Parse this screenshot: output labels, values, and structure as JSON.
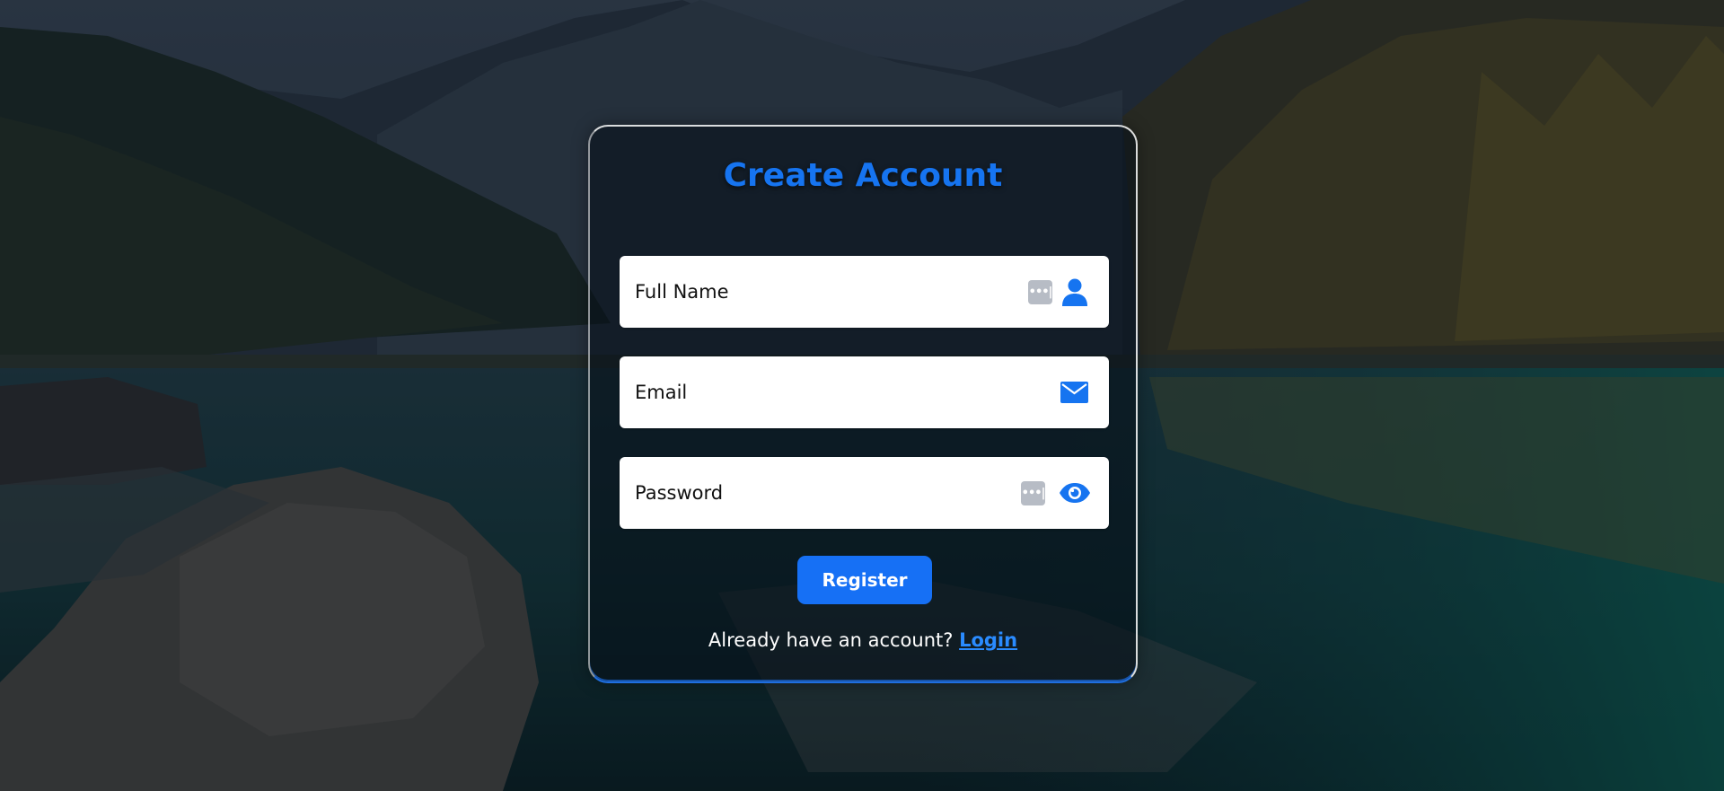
{
  "form": {
    "title": "Create Account",
    "fields": [
      {
        "placeholder": "Full Name",
        "value": "",
        "icon": "user-icon",
        "autofill": true
      },
      {
        "placeholder": "Email",
        "value": "",
        "icon": "envelope-icon",
        "autofill": false
      },
      {
        "placeholder": "Password",
        "value": "",
        "icon": "eye-icon",
        "autofill": true
      }
    ],
    "register_label": "Register",
    "footer_text": "Already have an account?",
    "login_label": "Login"
  },
  "colors": {
    "accent": "#1674f0",
    "button": "#1670f5",
    "link": "#2a8bff",
    "autofill_badge": "#b7bcc5"
  }
}
